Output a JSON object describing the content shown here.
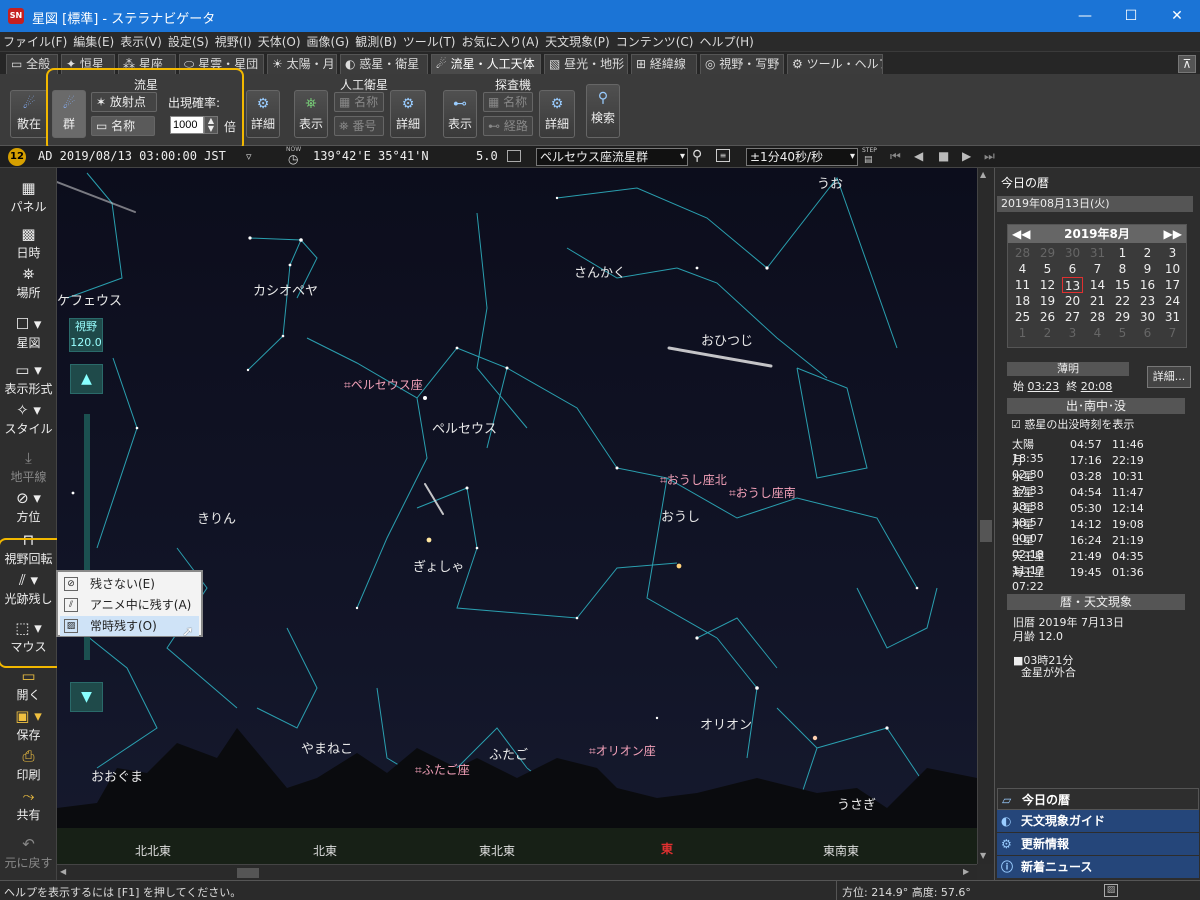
{
  "window": {
    "title": "星図 [標準] - ステラナビゲータ",
    "app_icon_text": "SN"
  },
  "menu": [
    "ファイル(F)",
    "編集(E)",
    "表示(V)",
    "設定(S)",
    "視野(I)",
    "天体(O)",
    "画像(G)",
    "観測(B)",
    "ツール(T)",
    "お気に入り(A)",
    "天文現象(P)",
    "コンテンツ(C)",
    "ヘルプ(H)"
  ],
  "tabs": [
    "全般",
    "恒星",
    "星座",
    "星雲・星団",
    "太陽・月",
    "惑星・衛星",
    "流星・人工天体",
    "昼光・地形",
    "経緯線",
    "視野・写野",
    "ツール・ヘルプ"
  ],
  "ribbon": {
    "meteor": {
      "title": "流星",
      "scatter": "散在",
      "group": "群",
      "radiant": "放射点",
      "name": "名称",
      "rate_label": "出現確率:",
      "rate_value": "1000",
      "rate_unit": "倍",
      "detail": "詳細"
    },
    "satellite": {
      "title": "人工衛星",
      "show": "表示",
      "name": "名称",
      "number": "番号",
      "detail": "詳細"
    },
    "probe": {
      "title": "探査機",
      "show": "表示",
      "name": "名称",
      "path": "経路",
      "detail": "詳細"
    },
    "search": "検索"
  },
  "infobar": {
    "date": "AD 2019/08/13 03:00:00 JST",
    "now_label": "NOW",
    "position": "139°42'E 35°41'N",
    "mag": "5.0",
    "target": "ペルセウス座流星群",
    "step": "±1分40秒/秒",
    "step_label": "STEP"
  },
  "leftbar": {
    "panel": "パネル",
    "datetime": "日時",
    "place": "場所",
    "starmap": "星図",
    "display": "表示形式",
    "style": "スタイル",
    "horizon": "地平線",
    "direction": "方位",
    "rotate": "視野回転",
    "trail": "光跡残し",
    "mouse": "マウス",
    "open": "開く",
    "save": "保存",
    "print": "印刷",
    "share": "共有",
    "undo": "元に戻す"
  },
  "fov": {
    "label": "視野",
    "value": "120.0"
  },
  "trail_menu": [
    "残さない(E)",
    "アニメ中に残す(A)",
    "常時残す(O)"
  ],
  "constellations": [
    "うお",
    "ケフェウス",
    "カシオペヤ",
    "さんかく",
    "おひつじ",
    "ペルセウス",
    "きりん",
    "おうし",
    "ぎょしゃ",
    "オリオン",
    "やまねこ",
    "ふたご",
    "うさぎ",
    "おおぐま"
  ],
  "radiants": [
    "ペルセウス座",
    "おうし座北",
    "おうし座南",
    "ふたご座",
    "オリオン座"
  ],
  "directions": [
    "北北東",
    "北東",
    "東北東",
    "東",
    "東南東"
  ],
  "rpanel": {
    "header": "今日の暦",
    "date": "2019年08月13日(火)",
    "month": "2019年8月",
    "calendar": [
      [
        28,
        29,
        30,
        31,
        1,
        2,
        3
      ],
      [
        4,
        5,
        6,
        7,
        8,
        9,
        10
      ],
      [
        11,
        12,
        13,
        14,
        15,
        16,
        17
      ],
      [
        18,
        19,
        20,
        21,
        22,
        23,
        24
      ],
      [
        25,
        26,
        27,
        28,
        29,
        30,
        31
      ],
      [
        1,
        2,
        3,
        4,
        5,
        6,
        7
      ]
    ],
    "twilight": "薄明",
    "start_label": "始",
    "start": "03:23",
    "end_label": "終",
    "end": "20:08",
    "detail": "詳細...",
    "riseset_title": "出･南中･没",
    "riseset_check": "惑星の出没時刻を表示",
    "riseset": [
      [
        "太陽",
        "04:57",
        "11:46",
        "18:35"
      ],
      [
        "月",
        "17:16",
        "22:19",
        "02:30"
      ],
      [
        "水星",
        "03:28",
        "10:31",
        "17:33"
      ],
      [
        "金星",
        "04:54",
        "11:47",
        "18:38"
      ],
      [
        "火星",
        "05:30",
        "12:14",
        "18:57"
      ],
      [
        "木星",
        "14:12",
        "19:08",
        "00:07"
      ],
      [
        "土星",
        "16:24",
        "21:19",
        "02:18"
      ],
      [
        "天王星",
        "21:49",
        "04:35",
        "11:17"
      ],
      [
        "海王星",
        "19:45",
        "01:36",
        "07:22"
      ]
    ],
    "events_title": "暦・天文現象",
    "old_cal": "旧暦 2019年 7月13日",
    "moon_age": "月齢 12.0",
    "event_time": "■03時21分",
    "event_text": "金星が外合",
    "nav": [
      "今日の暦",
      "天文現象ガイド",
      "更新情報",
      "新着ニュース"
    ]
  },
  "status": {
    "help": "ヘルプを表示するには [F1] を押してください。",
    "azalt": "方位: 214.9° 高度: 57.6°"
  },
  "colors": {
    "title_bar": "#1b74d6",
    "highlight": "#f2b800",
    "constellation_line": "#2fb8c8",
    "radiant": "#f2a0b8"
  }
}
